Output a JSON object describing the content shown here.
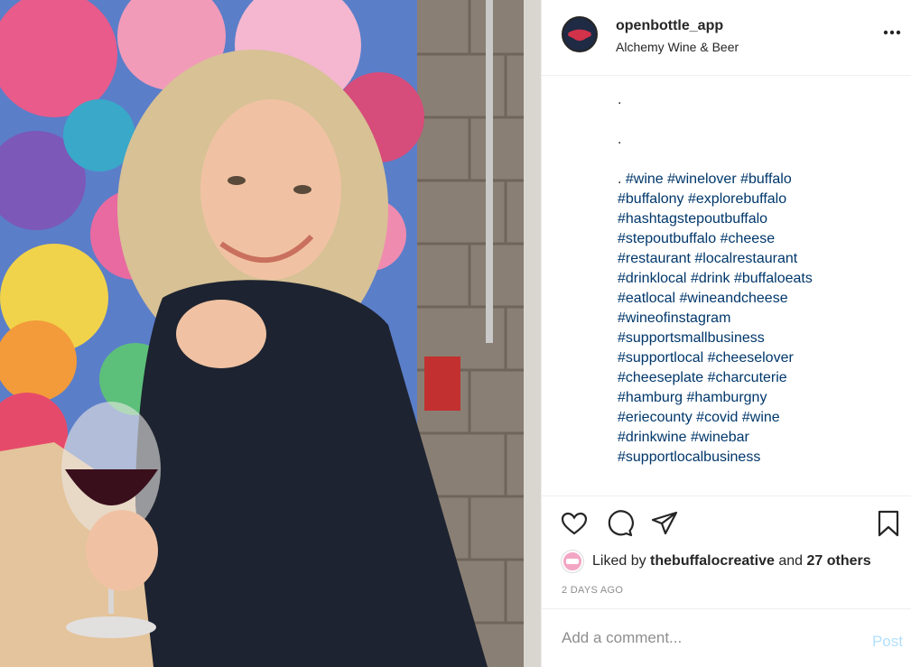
{
  "post": {
    "username": "openbottle_app",
    "location": "Alchemy Wine & Beer",
    "more_icon": "more-dots-icon",
    "avatar_colors": {
      "ring": "#262626",
      "inner": "#1f2a44",
      "accent": "#d3324b"
    }
  },
  "caption": {
    "dot_lines": [
      ".",
      "."
    ],
    "first_line_prefix": ". ",
    "lines": [
      [
        "#wine",
        "#winelover",
        "#buffalo"
      ],
      [
        "#buffalony",
        "#explorebuffalo"
      ],
      [
        "#hashtagstepoutbuffalo"
      ],
      [
        "#stepoutbuffalo",
        "#cheese"
      ],
      [
        "#restaurant",
        "#localrestaurant"
      ],
      [
        "#drinklocal",
        "#drink",
        "#buffaloeats"
      ],
      [
        "#eatlocal",
        "#wineandcheese"
      ],
      [
        "#wineofinstagram"
      ],
      [
        "#supportsmallbusiness"
      ],
      [
        "#supportlocal",
        "#cheeselover"
      ],
      [
        "#cheeseplate",
        "#charcuterie"
      ],
      [
        "#hamburg",
        "#hamburgny"
      ],
      [
        "#eriecounty",
        "#covid",
        "#wine"
      ],
      [
        "#drinkwine",
        "#winebar"
      ],
      [
        "#supportlocalbusiness"
      ]
    ],
    "hashtag_color": "#00376b"
  },
  "actions": {
    "like_icon": "heart-icon",
    "comment_icon": "comment-bubble-icon",
    "share_icon": "paper-plane-icon",
    "save_icon": "bookmark-icon"
  },
  "likes": {
    "prefix": "Liked by",
    "user": "thebuffalocreative",
    "conj": "and",
    "others": "27 others"
  },
  "timestamp": "2 days ago",
  "comment": {
    "placeholder": "Add a comment...",
    "post_label": "Post",
    "post_color": "#b2dffc"
  }
}
